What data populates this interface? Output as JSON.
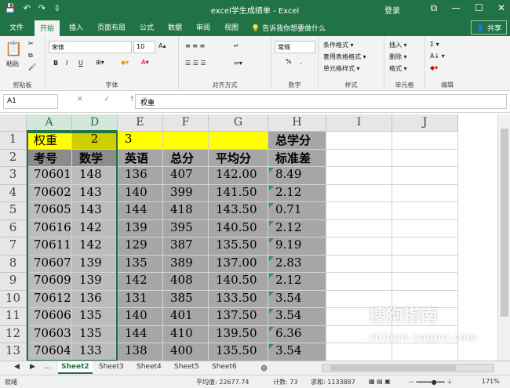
{
  "app": {
    "title": "excel学生成绩单  -  Excel",
    "login": "登录",
    "quick_access": [
      "💾",
      "↶",
      "↷",
      "⇩"
    ],
    "window_buttons": [
      "⧉",
      "—",
      "☐",
      "✕"
    ]
  },
  "ribbon_tabs": [
    {
      "label": "文件"
    },
    {
      "label": "开始"
    },
    {
      "label": "插入"
    },
    {
      "label": "页面布局"
    },
    {
      "label": "公式"
    },
    {
      "label": "数据"
    },
    {
      "label": "审阅"
    },
    {
      "label": "视图"
    }
  ],
  "tellme": "💡 告诉我你想要做什么",
  "share": "👤 共享",
  "ribbon": {
    "clipboard": {
      "paste": "粘贴",
      "label": "剪贴板"
    },
    "font": {
      "name": "宋体",
      "size": "10",
      "bold": "B",
      "italic": "I",
      "underline": "U",
      "label": "字体"
    },
    "alignment": {
      "label": "对齐方式"
    },
    "number": {
      "format": "常规",
      "percent": "%",
      "comma": ",",
      "label": "数字"
    },
    "styles": {
      "cond": "条件格式 ▾",
      "table": "套用表格格式 ▾",
      "cell": "单元格样式 ▾",
      "label": "样式"
    },
    "cells": {
      "insert": "插入 ▾",
      "delete": "删除 ▾",
      "format": "格式 ▾",
      "label": "单元格"
    },
    "editing": {
      "sum": "Σ ▾",
      "sort": "A↓ ▾",
      "label": "编辑"
    }
  },
  "formula_bar": {
    "name_box": "A1",
    "fx": "✕ ✓ fx",
    "content": "权重"
  },
  "columns": [
    "A",
    "D",
    "E",
    "F",
    "G",
    "H",
    "I",
    "J"
  ],
  "rows": [
    "1",
    "2",
    "3",
    "4",
    "5",
    "6",
    "7",
    "8",
    "9",
    "10",
    "11",
    "12",
    "13"
  ],
  "row1": {
    "A": "权重",
    "D": "2",
    "E": "3",
    "H": "总学分"
  },
  "row2": {
    "A": "考号",
    "D": "数学",
    "E": "英语",
    "F": "总分",
    "G": "平均分",
    "H": "标准差"
  },
  "data_rows": [
    {
      "A": "70601",
      "D": "148",
      "E": "136",
      "F": "407",
      "G": "142.00",
      "H": "8.49"
    },
    {
      "A": "70602",
      "D": "143",
      "E": "140",
      "F": "399",
      "G": "141.50",
      "H": "2.12"
    },
    {
      "A": "70605",
      "D": "143",
      "E": "144",
      "F": "418",
      "G": "143.50",
      "H": "0.71"
    },
    {
      "A": "70616",
      "D": "142",
      "E": "139",
      "F": "395",
      "G": "140.50",
      "H": "2.12"
    },
    {
      "A": "70611",
      "D": "142",
      "E": "129",
      "F": "387",
      "G": "135.50",
      "H": "9.19"
    },
    {
      "A": "70607",
      "D": "139",
      "E": "135",
      "F": "389",
      "G": "137.00",
      "H": "2.83"
    },
    {
      "A": "70609",
      "D": "139",
      "E": "142",
      "F": "408",
      "G": "140.50",
      "H": "2.12"
    },
    {
      "A": "70612",
      "D": "136",
      "E": "131",
      "F": "385",
      "G": "133.50",
      "H": "3.54"
    },
    {
      "A": "70606",
      "D": "135",
      "E": "140",
      "F": "401",
      "G": "137.50",
      "H": "3.54"
    },
    {
      "A": "70603",
      "D": "135",
      "E": "144",
      "F": "410",
      "G": "139.50",
      "H": "6.36"
    },
    {
      "A": "70604",
      "D": "133",
      "E": "138",
      "F": "400",
      "G": "135.50",
      "H": "3.54"
    }
  ],
  "sheets": [
    "Sheet2",
    "Sheet3",
    "Sheet4",
    "Sheet5",
    "Sheet6"
  ],
  "sheet_nav": [
    "◀",
    "▶",
    "..."
  ],
  "add_sheet": "⊕",
  "status": {
    "ready": "就绪",
    "average": "平均值: 22677.74",
    "count": "计数: 73",
    "sum": "求和: 1133887",
    "zoom": "171%"
  },
  "watermark": {
    "text": "搜狗指南",
    "url": "zhinan.sogou.com"
  }
}
